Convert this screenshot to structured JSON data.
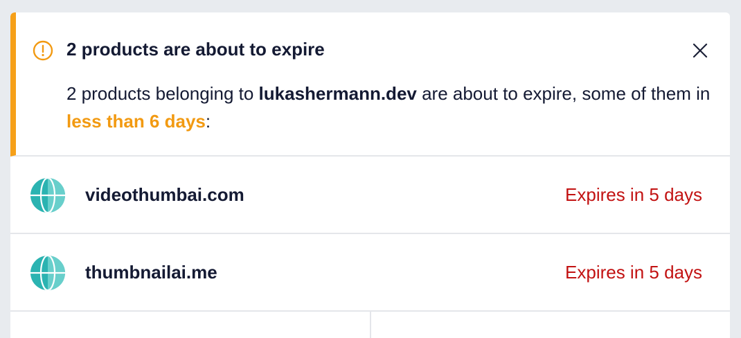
{
  "alert": {
    "icon": "exclamation-circle-icon",
    "title": "2 products are about to expire",
    "body_prefix": "2 products belonging to ",
    "owner": "lukashermann.dev",
    "body_middle": " are about to expire, some of them in ",
    "highlight": "less than 6 days",
    "body_suffix": ":",
    "close_icon": "close-icon",
    "accent_color": "#f6a019"
  },
  "products": [
    {
      "icon": "globe-icon",
      "domain": "videothumbai.com",
      "status": "Expires in 5 days"
    },
    {
      "icon": "globe-icon",
      "domain": "thumbnailai.me",
      "status": "Expires in 5 days"
    }
  ],
  "colors": {
    "warning": "#f29a12",
    "danger": "#c21212",
    "globe": "#2bb3b1"
  }
}
